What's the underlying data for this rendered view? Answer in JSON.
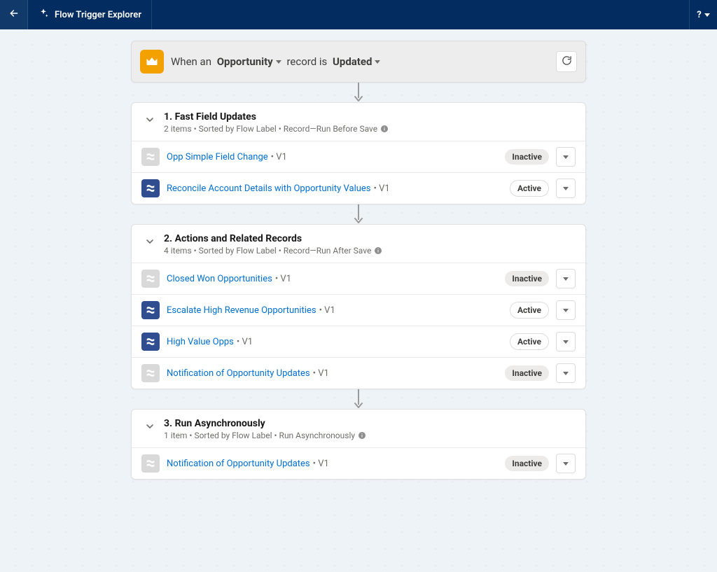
{
  "topbar": {
    "title": "Flow Trigger Explorer",
    "help_label": "?"
  },
  "header": {
    "prefix": "When an ",
    "object": "Opportunity",
    "middle": " record is ",
    "trigger": "Updated"
  },
  "sections": [
    {
      "title": "1. Fast Field Updates",
      "sub": "2 items • Sorted by Flow Label • Record—Run Before Save",
      "rows": [
        {
          "name": "Opp Simple Field Change",
          "version": "V1",
          "status": "Inactive"
        },
        {
          "name": "Reconcile Account Details with Opportunity Values",
          "version": "V1",
          "status": "Active"
        }
      ]
    },
    {
      "title": "2. Actions and Related Records",
      "sub": "4 items • Sorted by Flow Label • Record—Run After Save",
      "rows": [
        {
          "name": "Closed Won Opportunities",
          "version": "V1",
          "status": "Inactive"
        },
        {
          "name": "Escalate High Revenue Opportunities",
          "version": "V1",
          "status": "Active"
        },
        {
          "name": "High Value Opps",
          "version": "V1",
          "status": "Active"
        },
        {
          "name": "Notification of Opportunity Updates",
          "version": "V1",
          "status": "Inactive"
        }
      ]
    },
    {
      "title": "3. Run Asynchronously",
      "sub": "1 item • Sorted by Flow Label • Run Asynchronously",
      "rows": [
        {
          "name": "Notification of Opportunity Updates",
          "version": "V1",
          "status": "Inactive"
        }
      ]
    }
  ]
}
